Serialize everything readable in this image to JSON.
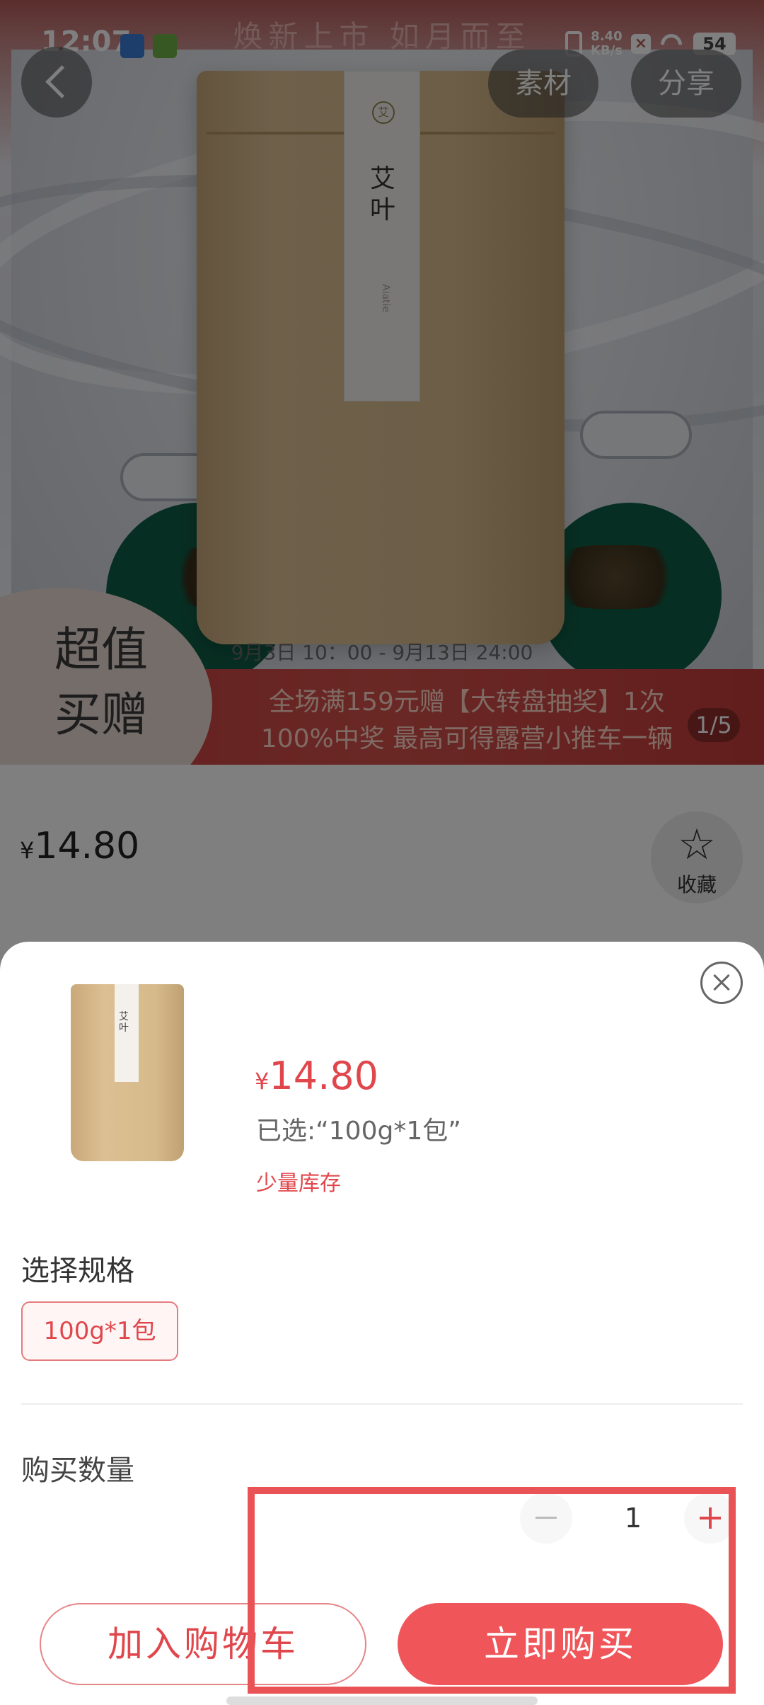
{
  "status_bar": {
    "time": "12:07",
    "net_speed_value": "8.40",
    "net_speed_unit": "KB/s",
    "battery": "54"
  },
  "header": {
    "back_icon": "chevron-left-icon",
    "material_label": "素材",
    "share_label": "分享"
  },
  "hero": {
    "top_text": "焕新上市 如月而至",
    "bag_title": "艾叶",
    "bag_logo": "艾",
    "bag_subtitle": "Aiatie",
    "promo_badge_line1": "超值",
    "promo_badge_line2": "买赠",
    "promo_date": "9月3日 10：00 - 9月13日 24:00",
    "promo_line1": "全场满159元赠【大转盘抽奖】1次",
    "promo_line2": "100%中奖 最高可得露营小推车一辆",
    "pager": "1/5"
  },
  "product": {
    "currency": "¥",
    "price": "14.80",
    "favorite_label": "收藏"
  },
  "sheet": {
    "thumb_title": "艾叶",
    "currency": "¥",
    "price": "14.80",
    "selected_text": "已选:“100g*1包”",
    "stock_text": "少量库存",
    "spec_title": "选择规格",
    "spec_option": "100g*1包",
    "qty_title": "购买数量",
    "qty_value": "1",
    "add_to_cart": "加入购物车",
    "buy_now": "立即购买"
  },
  "colors": {
    "accent": "#e0474c",
    "buy_button": "#f0555a",
    "highlight_box": "#ea5356"
  }
}
